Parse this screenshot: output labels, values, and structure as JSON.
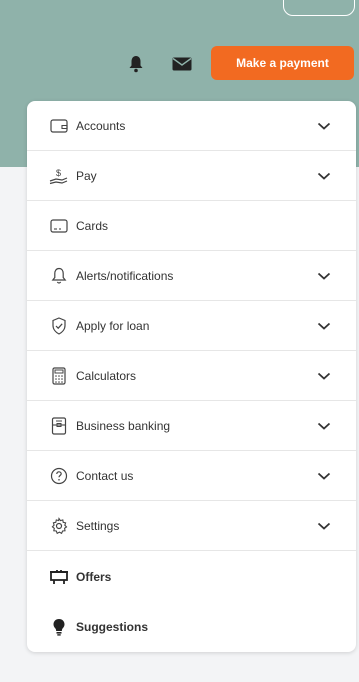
{
  "header": {
    "bell_icon": "bell-icon",
    "mail_icon": "envelope-icon",
    "payment_button": "Make a payment",
    "accent": "#f26a21",
    "background": "#8fb2aa"
  },
  "menu": {
    "items": [
      {
        "label": "Accounts",
        "icon": "wallet-icon",
        "expandable": true
      },
      {
        "label": "Pay",
        "icon": "hand-money-icon",
        "expandable": true
      },
      {
        "label": "Cards",
        "icon": "card-icon",
        "expandable": false
      },
      {
        "label": "Alerts/notifications",
        "icon": "bell-icon",
        "expandable": true
      },
      {
        "label": "Apply for loan",
        "icon": "shield-check-icon",
        "expandable": true
      },
      {
        "label": "Calculators",
        "icon": "calculator-icon",
        "expandable": true
      },
      {
        "label": "Business banking",
        "icon": "briefcase-icon",
        "expandable": true
      },
      {
        "label": "Contact us",
        "icon": "question-circle-icon",
        "expandable": true
      },
      {
        "label": "Settings",
        "icon": "gear-icon",
        "expandable": true
      },
      {
        "label": "Offers",
        "icon": "offers-board-icon",
        "expandable": false
      },
      {
        "label": "Suggestions",
        "icon": "lightbulb-icon",
        "expandable": false
      }
    ]
  }
}
